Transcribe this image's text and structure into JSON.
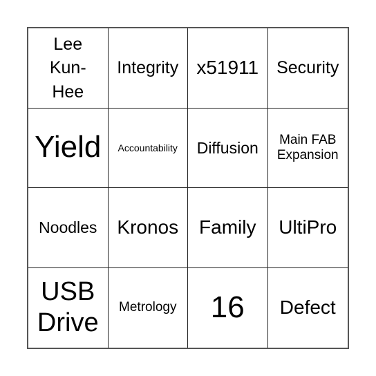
{
  "board": {
    "rows": 4,
    "cols": 4,
    "cells": [
      {
        "text": "Lee Kun-Hee"
      },
      {
        "text": "Integrity"
      },
      {
        "text": "x51911"
      },
      {
        "text": "Security"
      },
      {
        "text": "Yield"
      },
      {
        "text": "Accountability"
      },
      {
        "text": "Diffusion"
      },
      {
        "text": "Main FAB Expansion"
      },
      {
        "text": "Noodles"
      },
      {
        "text": "Kronos"
      },
      {
        "text": "Family"
      },
      {
        "text": "UltiPro"
      },
      {
        "text": "USB Drive"
      },
      {
        "text": "Metrology"
      },
      {
        "text": "16"
      },
      {
        "text": "Defect"
      }
    ]
  }
}
